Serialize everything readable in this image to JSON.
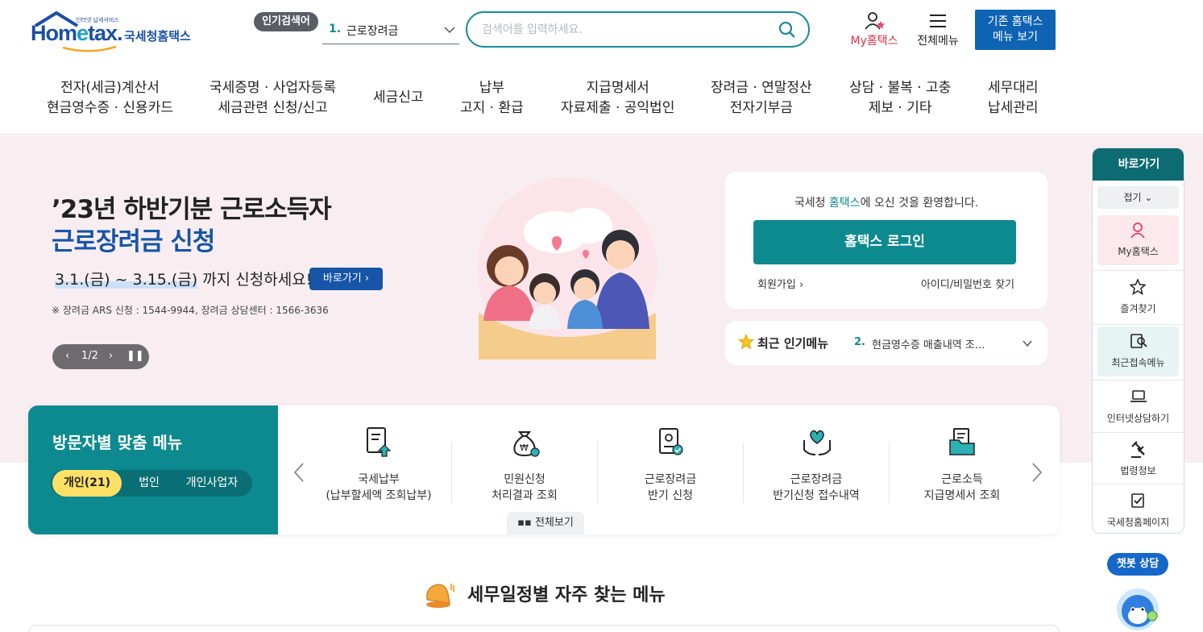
{
  "header": {
    "logo_tiny": "인터넷 납세서비스",
    "logo_main_a": "Hom",
    "logo_main_e": "e",
    "logo_main_b": "tax.",
    "logo_kr": "국세청홈택스",
    "popular_badge": "인기검색어",
    "popular_num": "1.",
    "popular_text": "근로장려금",
    "search_placeholder": "검색어를 입력하세요.",
    "my_hometax": "My홈택스",
    "all_menu": "전체메뉴",
    "old_btn_line1": "기존 홈택스",
    "old_btn_line2": "메뉴 보기"
  },
  "nav": [
    {
      "l1": "전자(세금)계산서",
      "l2": "현금영수증 · 신용카드"
    },
    {
      "l1": "국세증명 · 사업자등록",
      "l2": "세금관련 신청/신고"
    },
    {
      "l1": "세금신고",
      "l2": ""
    },
    {
      "l1": "납부",
      "l2": "고지 · 환급"
    },
    {
      "l1": "지급명세서",
      "l2": "자료제출 · 공익법인"
    },
    {
      "l1": "장려금 · 연말정산",
      "l2": "전자기부금"
    },
    {
      "l1": "상담 · 불복 · 고충",
      "l2": "제보 · 기타"
    },
    {
      "l1": "세무대리",
      "l2": "납세관리"
    }
  ],
  "hero": {
    "title1": "’23년 하반기분 근로소득자",
    "title2": "근로장려금 신청",
    "date_hl": "3.1.(금) ~ 3.15.(금)",
    "date_rest": " 까지 신청하세요!",
    "go_btn": "바로가기",
    "note": "※ 장려금 ARS 신청 : 1544-9944, 장려금 상담센터 : 1566-3636",
    "pager": "1/2"
  },
  "login": {
    "welcome_a": "국세청 ",
    "welcome_hl": "홈택스",
    "welcome_b": "에 오신 것을 환영합니다.",
    "login_btn": "홈택스 로그인",
    "join": "회원가입",
    "find": "아이디/비밀번호 찾기"
  },
  "recent": {
    "title": "최근 인기메뉴",
    "num": "2.",
    "text": "현금영수증 매출내역 조..."
  },
  "quick": {
    "title": "방문자별 맞춤 메뉴",
    "tabs": [
      "개인(21)",
      "법인",
      "개인사업자"
    ],
    "items": [
      {
        "l1": "국세납부",
        "l2": "(납부할세액 조회납부)",
        "icon": "tax-payment-icon"
      },
      {
        "l1": "민원신청",
        "l2": "처리결과 조회",
        "icon": "money-bag-icon"
      },
      {
        "l1": "근로장려금",
        "l2": "반기 신청",
        "icon": "certificate-icon"
      },
      {
        "l1": "근로장려금",
        "l2": "반기신청 접수내역",
        "icon": "heart-hands-icon"
      },
      {
        "l1": "근로소득",
        "l2": "지급명세서 조회",
        "icon": "folder-document-icon"
      }
    ],
    "view_all": "전체보기"
  },
  "rpanel": {
    "head": "바로가기",
    "fold": "접기",
    "items": [
      {
        "label": "My홈택스",
        "icon": "user-icon"
      },
      {
        "label": "즐겨찾기",
        "icon": "star-icon"
      },
      {
        "label": "최근접속메뉴",
        "icon": "recent-search-icon"
      },
      {
        "label": "인터넷상담하기",
        "icon": "laptop-icon"
      },
      {
        "label": "법령정보",
        "icon": "gavel-icon"
      },
      {
        "label": "국세청홈페이지",
        "icon": "checklist-icon"
      }
    ]
  },
  "chatbot": "챗봇 상담",
  "section_title": "세무일정별 자주 찾는 메뉴",
  "colors": {
    "teal": "#0d8a8f",
    "blue": "#1655a8",
    "pink_bg": "#f8eef1",
    "highlight": "#ffe066"
  }
}
